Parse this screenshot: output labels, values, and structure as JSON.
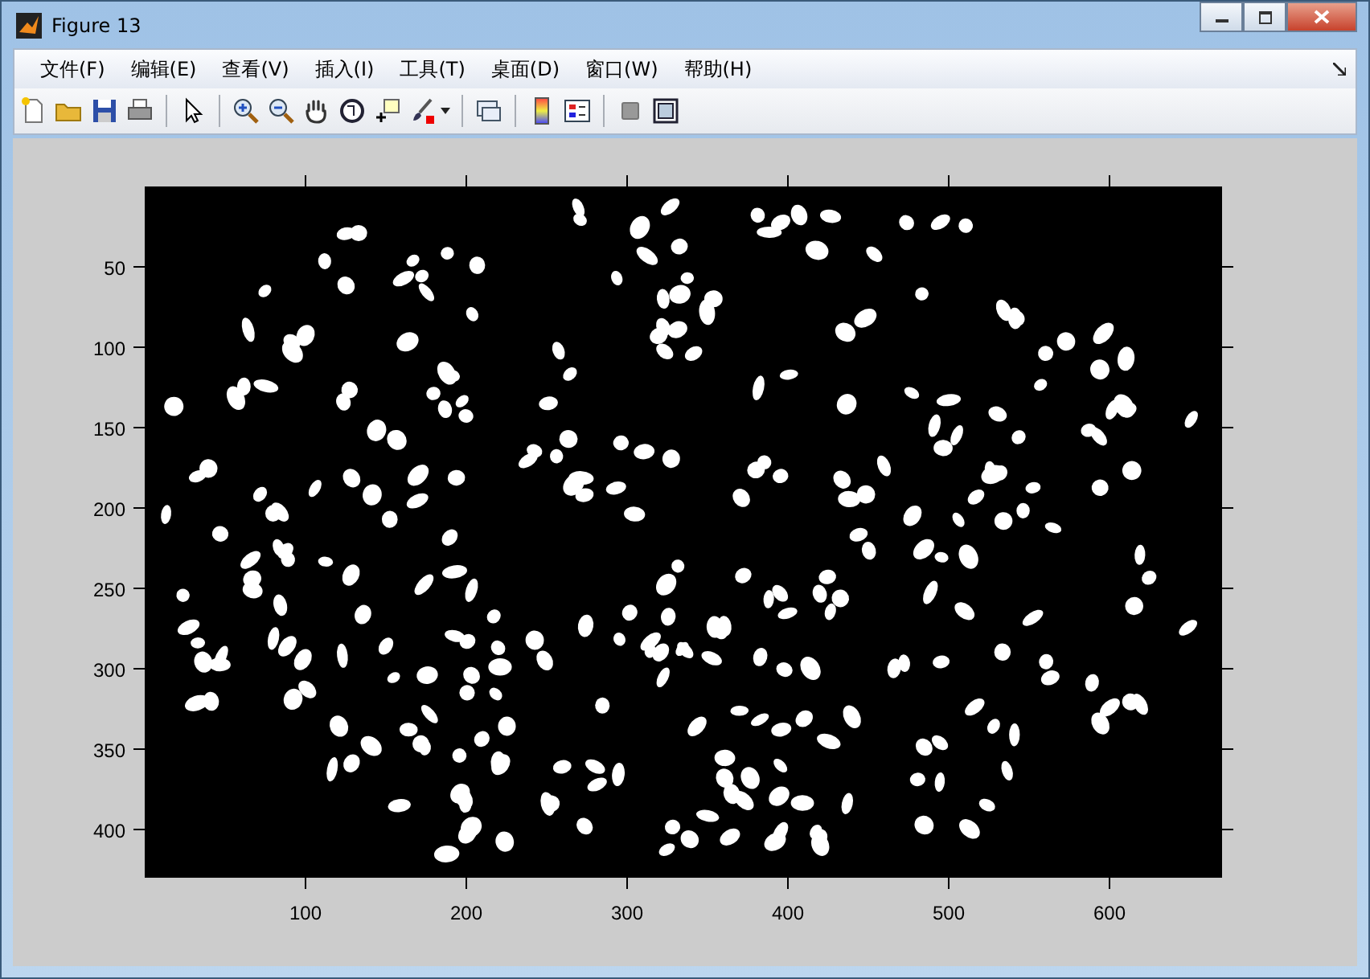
{
  "window": {
    "title": "Figure 13"
  },
  "menu": [
    {
      "label": "文件(F)"
    },
    {
      "label": "编辑(E)"
    },
    {
      "label": "查看(V)"
    },
    {
      "label": "插入(I)"
    },
    {
      "label": "工具(T)"
    },
    {
      "label": "桌面(D)"
    },
    {
      "label": "窗口(W)"
    },
    {
      "label": "帮助(H)"
    }
  ],
  "axes": {
    "xticks": [
      "100",
      "200",
      "300",
      "400",
      "500",
      "600"
    ],
    "yticks": [
      "50",
      "100",
      "150",
      "200",
      "250",
      "300",
      "350",
      "400"
    ]
  }
}
